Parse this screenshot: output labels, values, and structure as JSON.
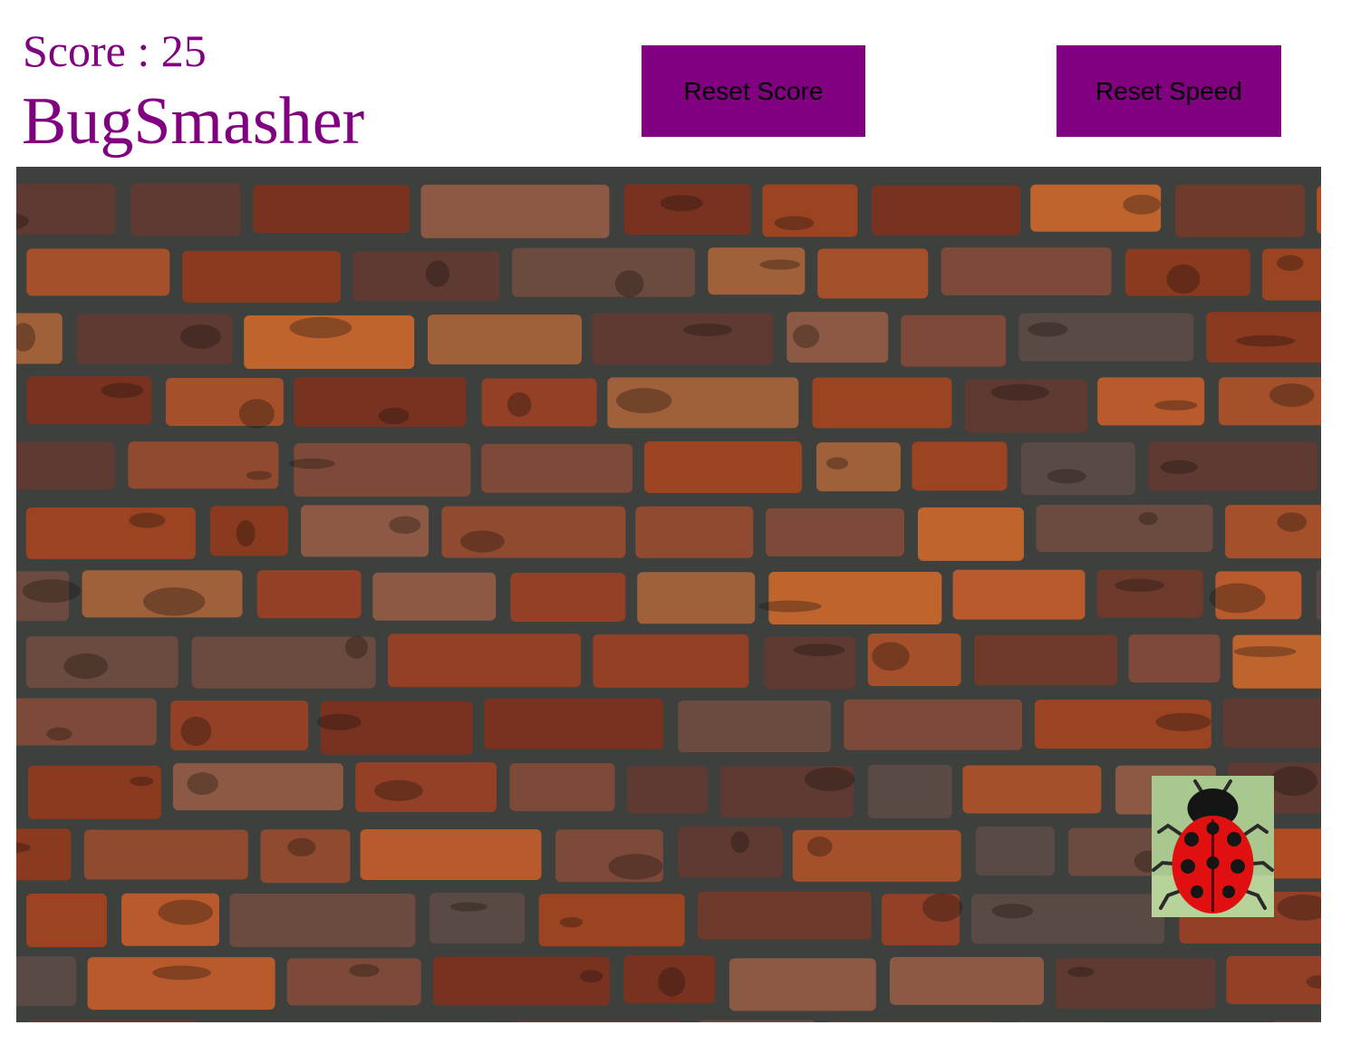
{
  "header": {
    "score_label": "Score : 25",
    "title": "BugSmasher"
  },
  "buttons": {
    "reset_score": "Reset Score",
    "reset_speed": "Reset Speed"
  },
  "game": {
    "score": 25,
    "background": "brick-wall",
    "bug": "ladybug-icon"
  },
  "colors": {
    "accent": "#800080",
    "button_text": "#000000",
    "mortar": "#3d403d",
    "bug_red": "#e01010",
    "bug_bg": "#a8c890"
  }
}
